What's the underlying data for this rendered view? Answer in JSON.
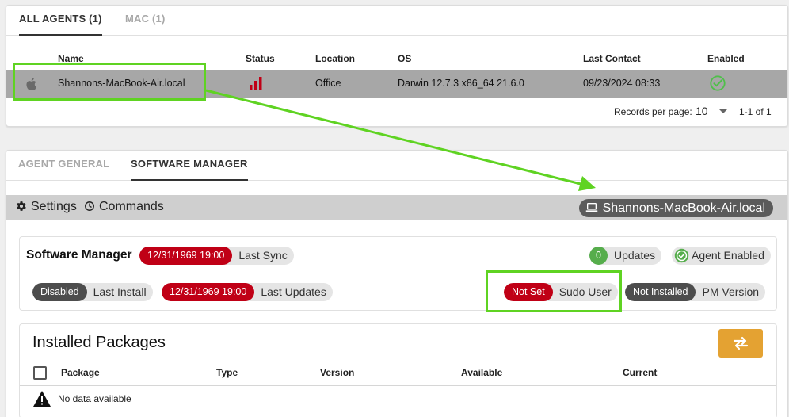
{
  "agents_tabs": [
    {
      "label": "ALL AGENTS (1)",
      "active": true
    },
    {
      "label": "MAC (1)",
      "active": false
    }
  ],
  "agents_table": {
    "columns": [
      "Name",
      "Status",
      "Location",
      "OS",
      "Last Contact",
      "Enabled"
    ],
    "rows": [
      {
        "icon": "apple-icon",
        "name": "Shannons-MacBook-Air.local",
        "status_icon": "signal-bars-icon",
        "location": "Office",
        "os": "Darwin 12.7.3 x86_64 21.6.0",
        "last_contact": "09/23/2024 08:33",
        "enabled_icon": "check-circle-icon"
      }
    ]
  },
  "pagination": {
    "records_label": "Records per page:",
    "per_page": "10",
    "range": "1-1 of 1"
  },
  "detail_tabs": [
    {
      "label": "AGENT GENERAL",
      "active": false
    },
    {
      "label": "SOFTWARE MANAGER",
      "active": true
    }
  ],
  "toolbar": {
    "settings_label": "Settings",
    "commands_label": "Commands",
    "hostname": "Shannons-MacBook-Air.local"
  },
  "software_manager": {
    "title": "Software Manager",
    "last_sync": {
      "value": "12/31/1969 19:00",
      "label": "Last Sync"
    },
    "updates": {
      "value": "0",
      "label": "Updates"
    },
    "agent_enabled": {
      "label": "Agent Enabled"
    },
    "last_install": {
      "value": "Disabled",
      "label": "Last Install"
    },
    "last_updates": {
      "value": "12/31/1969 19:00",
      "label": "Last Updates"
    },
    "sudo_user": {
      "value": "Not Set",
      "label": "Sudo User"
    },
    "pm_version": {
      "value": "Not Installed",
      "label": "PM Version"
    }
  },
  "installed_packages": {
    "title": "Installed Packages",
    "columns": [
      "Package",
      "Type",
      "Version",
      "Available",
      "Current"
    ],
    "empty_text": "No data available"
  },
  "colors": {
    "highlight": "#5fd322",
    "red_chip": "#c00016",
    "dark_chip": "#4d4d4d",
    "green_chip": "#56ad4c",
    "sync_button": "#e4a232",
    "status_red": "#c00016",
    "enabled_green": "#4fbf4a"
  }
}
